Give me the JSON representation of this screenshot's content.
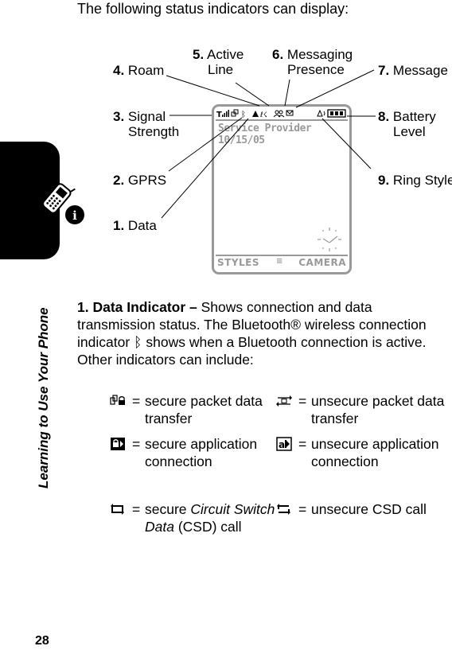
{
  "page": {
    "intro": "The following status indicators can display:",
    "section_title": "Learning to Use Your Phone",
    "page_number": "28"
  },
  "callouts": [
    {
      "num": "1.",
      "label": "Data"
    },
    {
      "num": "2.",
      "label": "GPRS"
    },
    {
      "num": "3.",
      "label_line1": "Signal",
      "label_line2": "Strength"
    },
    {
      "num": "4.",
      "label": "Roam"
    },
    {
      "num": "5.",
      "label_line1": "Active",
      "label_line2": "Line"
    },
    {
      "num": "6.",
      "label_line1": "Messaging",
      "label_line2": "Presence"
    },
    {
      "num": "7.",
      "label": "Message"
    },
    {
      "num": "8.",
      "label_line1": "Battery",
      "label_line2": "Level"
    },
    {
      "num": "9.",
      "label": "Ring Style"
    }
  ],
  "phone_screen": {
    "provider": "Service Provider",
    "date": "10/15/05",
    "left_softkey": "STYLES",
    "right_softkey": "CAMERA",
    "status_icons": [
      "signal-strength-icon",
      "gprs-icon",
      "bluetooth-icon",
      "roam-icon",
      "active-line-icon",
      "messaging-presence-icon",
      "message-icon",
      "ring-style-icon",
      "battery-icon"
    ]
  },
  "description": {
    "heading": "1. Data Indicator –",
    "text_1": " Shows connection and data transmission status. The Bluetooth® wireless connection indicator ",
    "text_2": " shows when a Bluetooth connection is active. Other indicators can include:"
  },
  "indicators": [
    {
      "icon": "secure-packet-data-icon",
      "eq": "=",
      "text": "secure packet data transfer"
    },
    {
      "icon": "unsecure-packet-data-icon",
      "eq": "=",
      "text": "unsecure packet data transfer"
    },
    {
      "icon": "secure-application-icon",
      "eq": "=",
      "text": "secure application connection"
    },
    {
      "icon": "unsecure-application-icon",
      "eq": "=",
      "text": "unsecure application connection"
    },
    {
      "icon": "secure-csd-icon",
      "eq": "=",
      "text_pre": "secure ",
      "text_italic": "Circuit Switch Data",
      "text_post": " (CSD) call"
    },
    {
      "icon": "unsecure-csd-icon",
      "eq": "=",
      "text": "unsecure CSD call"
    }
  ]
}
